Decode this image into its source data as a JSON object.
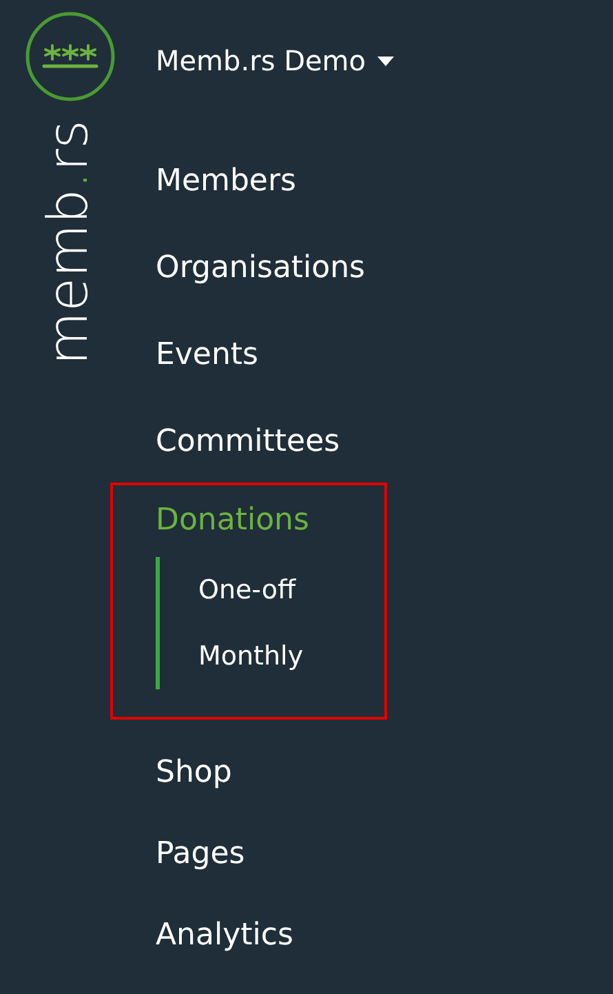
{
  "logo": {
    "parts": [
      {
        "text": "memb",
        "accent": false
      },
      {
        "text": ".",
        "accent": true
      },
      {
        "text": "rs",
        "accent": false
      }
    ]
  },
  "workspace": {
    "label": "Memb.rs Demo"
  },
  "nav": [
    {
      "label": "Members",
      "selected": false
    },
    {
      "label": "Organisations",
      "selected": false
    },
    {
      "label": "Events",
      "selected": false
    },
    {
      "label": "Committees",
      "selected": false
    },
    {
      "label": "Donations",
      "selected": true,
      "expanded": true,
      "highlighted": true,
      "children": [
        {
          "label": "One-off",
          "selected": false
        },
        {
          "label": "Monthly",
          "selected": false
        }
      ]
    },
    {
      "label": "Shop",
      "selected": false
    },
    {
      "label": "Pages",
      "selected": false
    },
    {
      "label": "Analytics",
      "selected": false
    }
  ]
}
